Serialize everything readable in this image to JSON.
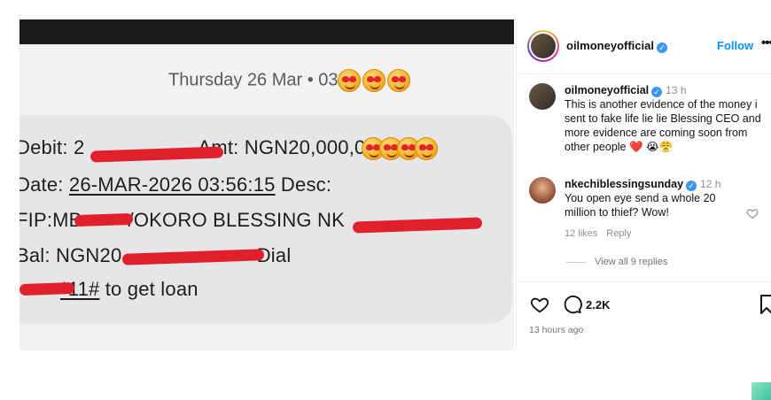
{
  "sms": {
    "date_line": "Thursday 26 Mar • 03:",
    "line1_a": "Debit: 2",
    "line1_b": "Amt: NGN20,000,0",
    "line2_a": "Date: ",
    "line2_b": "26-MAR-2026 03:56:15",
    "line2_c": " Desc:",
    "line3_a": "FIP:MB",
    "line3_b": "/OKORO BLESSING NK",
    "line4_a": "Bal: NGN20",
    "line4_b": " Dial",
    "line5_a": "*11#",
    "line5_b": " to get loan"
  },
  "post": {
    "username": "oilmoneyofficial",
    "follow_label": "Follow",
    "more_label": "•••",
    "caption_user": "oilmoneyofficial",
    "caption_time": "13 h",
    "caption_text": "This is another evidence of the money i sent to fake life lie lie Blessing CEO and more evidence are coming soon from other people ❤️ 😭😤",
    "comment_user": "nkechiblessingsunday",
    "comment_time": "12 h",
    "comment_text": "You open eye send a whole 20 million to thief? Wow!",
    "comment_likes": "12 likes",
    "comment_reply": "Reply",
    "view_replies": "View all 9 replies",
    "comment_count": "2.2K",
    "post_time": "13 hours ago"
  },
  "colors": {
    "accent": "#0095f6",
    "verified": "#3897f0",
    "redaction": "#e0202a"
  },
  "icons": [
    "verified-icon",
    "heart-icon",
    "comment-icon",
    "save-icon",
    "emoji-heart-eyes-icon"
  ]
}
